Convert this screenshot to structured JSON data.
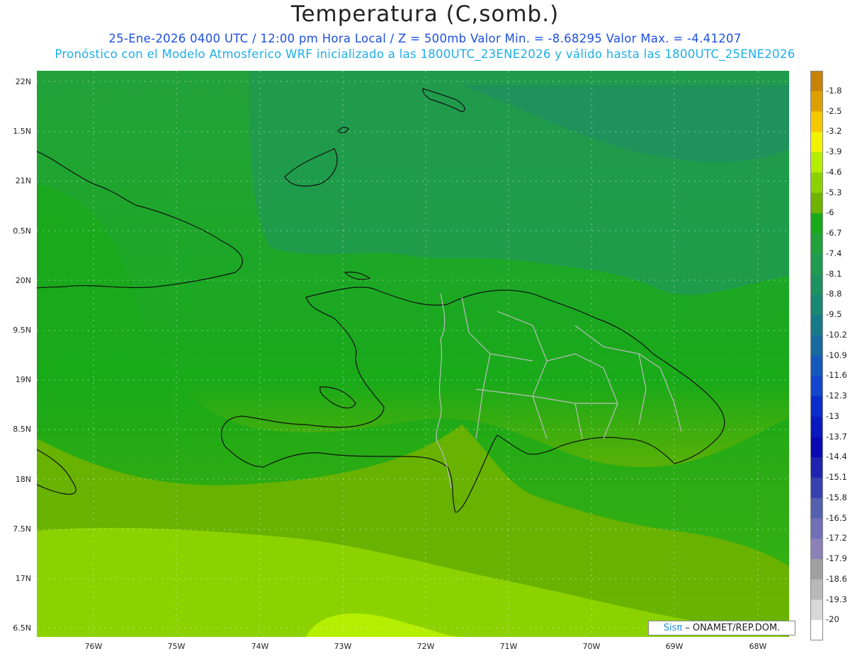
{
  "title": "Temperatura (C,somb.)",
  "subtitle_1": "25-Ene-2026  0400 UTC / 12:00 pm Hora Local / Z = 500mb  Valor Min. = -8.68295  Valor Max. = -4.41207",
  "subtitle_2": "Pronóstico con el Modelo Atmosferico WRF inicializado a las 1800UTC_23ENE2026 y válido hasta las  1800UTC_25ENE2026",
  "lat_labels": [
    "22N",
    "1.5N",
    "21N",
    "0.5N",
    "20N",
    "9.5N",
    "19N",
    "8.5N",
    "18N",
    "7.5N",
    "17N",
    "6.5N"
  ],
  "lon_labels": [
    "76W",
    "75W",
    "74W",
    "73W",
    "72W",
    "71W",
    "70W",
    "69W",
    "68W"
  ],
  "colorbar": {
    "labels": [
      "-1.8",
      "-2.5",
      "-3.2",
      "-3.9",
      "-4.6",
      "-5.3",
      "-6",
      "-6.7",
      "-7.4",
      "-8.1",
      "-8.8",
      "-9.5",
      "-10.2",
      "-10.9",
      "-11.6",
      "-12.3",
      "-13",
      "-13.7",
      "-14.4",
      "-15.1",
      "-15.8",
      "-16.5",
      "-17.2",
      "-17.9",
      "-18.6",
      "-19.3",
      "-20"
    ],
    "colors": [
      "#c8820a",
      "#dea000",
      "#f5c800",
      "#f2f200",
      "#b4ee00",
      "#8cd200",
      "#6fb200",
      "#19aa19",
      "#23a23c",
      "#209a50",
      "#1f9060",
      "#1a8872",
      "#177a88",
      "#166aa0",
      "#1458bc",
      "#1346cc",
      "#0b2ccc",
      "#0a1ac0",
      "#0a0ab4",
      "#1e24b0",
      "#3840b0",
      "#5460b0",
      "#7070b8",
      "#8c80b8",
      "#a0a0a0",
      "#b8b8b8",
      "#d8d8d8",
      "#ffffff"
    ]
  },
  "credit": {
    "brand": "Sisπ",
    "text": " – ONAMET/REP.DOM."
  }
}
